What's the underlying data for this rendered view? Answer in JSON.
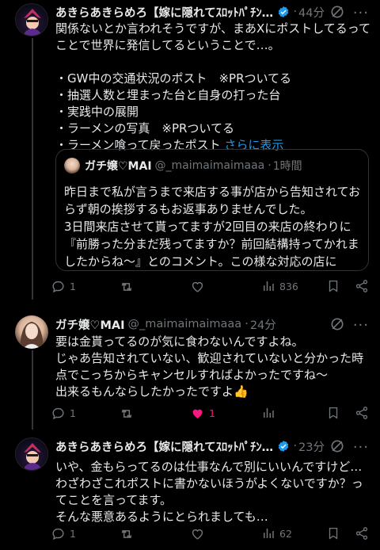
{
  "posts": [
    {
      "name": "あきらあきらめろ【嫁に隠れてｽﾛｯﾄﾊﾟﾁﾝｺ...",
      "time": "44分",
      "text": "関係ないとか言われそうですが、まあXにポストしてるってことで世界に発信してるということで…。\n\n・GW中の交通状況のポスト　※PRついてる\n・抽選人数と埋まった台と自身の打った台\n・実践中の展開\n・ラーメンの写真　※PRついてる\n・ラーメン喰って戻ったポスト ",
      "show_more": "さらに表示",
      "quote": {
        "name": "ガチ嬢♡MAI",
        "handle": "@_maimaimaimaaa",
        "time": "1時間",
        "text": "昨日まで私が言うまで来店する事が店から告知されておらず朝の挨拶するもお返事ありませんでした。\n3日間来店させて貰ってますが2回目の来店の終わりに『前勝った分まだ残ってますか？前回結構持ってかれましたからね〜』とのコメント。この様な対応の店に"
      },
      "replies": "1",
      "views": "836"
    },
    {
      "name": "ガチ嬢♡MAI",
      "handle": "@_maimaimaimaaa",
      "time": "24分",
      "text": "要は金貰ってるのが気に食わないんですよね。\nじゃあ告知されていない、歓迎されていないと分かった時点でこっちからキャンセルすればよかったですね〜\n出来るもんならしたかったですよ👍",
      "replies": "1",
      "likes": "1"
    },
    {
      "name": "あきらあきらめろ【嫁に隠れてｽﾛｯﾄﾊﾟﾁﾝｺ...",
      "time": "23分",
      "text": "いや、金もらってるのは仕事なんで別にいいんですけど…\nわざわざこれポストに書かないほうがよくないですか？ってことを言ってます。\nそんな悪意あるようにとられましても…",
      "replies": "1",
      "views": "62"
    }
  ],
  "icons": {
    "reply": "reply-icon",
    "repost": "repost-icon",
    "like": "heart-icon",
    "views": "views-icon",
    "bookmark": "bookmark-icon",
    "share": "share-icon",
    "grok": "grok-icon",
    "more": "more-icon",
    "verified": "verified-badge-icon"
  },
  "colors": {
    "background": "#000000",
    "text": "#e7e9ea",
    "muted": "#71767b",
    "link": "#1d9bf0",
    "like": "#f91880"
  }
}
